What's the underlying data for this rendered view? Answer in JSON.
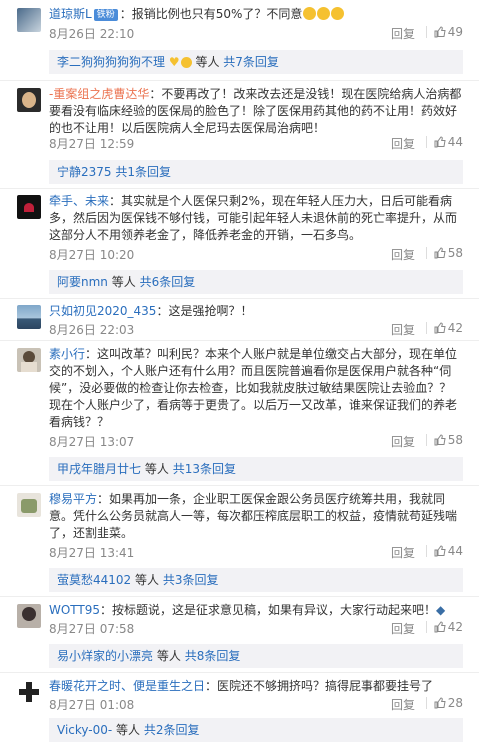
{
  "comments": [
    {
      "user": "道琼斯L",
      "badge": "铁粉",
      "text": "：报销比例也只有50%了？不同意",
      "time": "8月26日 22:10",
      "reply": "回复",
      "likes": "49",
      "sub_name": "李二狗狗狗狗狗不理",
      "sub_text": "等人",
      "sub_more": "共7条回复"
    },
    {
      "user": "-重案组之虎曹达华",
      "text": "：不要再改了！改来改去还是没钱！现在医院给病人治病都要看没有临床经验的医保局的脸色了！除了医保用药其他的药不让用！药效好的也不让用！以后医院病人全尼玛去医保局治病吧！",
      "time": "8月27日 12:59",
      "reply": "回复",
      "likes": "44",
      "sub_name": "宁静2375",
      "sub_text": "",
      "sub_more": "共1条回复"
    },
    {
      "user": "牵手、未来",
      "text": "：其实就是个人医保只剩2%，现在年轻人压力大，日后可能看病多，然后因为医保钱不够付钱，可能引起年轻人未退休前的死亡率提升，从而这部分人不用领养老金了，降低养老金的开销，一石多鸟。",
      "time": "8月27日 10:20",
      "reply": "回复",
      "likes": "58",
      "sub_name": "阿要nmn",
      "sub_text": "等人",
      "sub_more": "共6条回复"
    },
    {
      "user": "只如初见2020_435",
      "text": "：这是强抢啊？！",
      "time": "8月26日 22:03",
      "reply": "回复",
      "likes": "42"
    },
    {
      "user": "素小行",
      "text": "：这叫改革？叫利民？本来个人账户就是单位缴交占大部分，现在单位交的不划入，个人账户还有什么用？而且医院普遍看你是医保用户就各种“伺候”，没必要做的检查让你去检查，比如我就皮肤过敏结果医院让去验血？？现在个人账户少了，看病等于更贵了。以后万一又改革，谁来保证我们的养老看病钱？？",
      "time": "8月27日 13:07",
      "reply": "回复",
      "likes": "58",
      "sub_name": "甲戌年腊月廿七",
      "sub_text": "等人",
      "sub_more": "共13条回复"
    },
    {
      "user": "穆易平方",
      "text": "：如果再加一条，企业职工医保金跟公务员医疗统筹共用，我就同意。凭什么公务员就高人一等，每次都压榨底层职工的权益，疫情就苟延残喘了，还割韭菜。",
      "time": "8月27日 13:41",
      "reply": "回复",
      "likes": "44",
      "sub_name": "萤莫愁44102",
      "sub_text": "等人",
      "sub_more": "共3条回复"
    },
    {
      "user": "WOTT95",
      "text": "：按标题说，这是征求意见稿，如果有异议，大家行动起来吧！",
      "time": "8月27日 07:58",
      "reply": "回复",
      "likes": "42",
      "sub_name": "易小烊家的小漂亮",
      "sub_text": "等人",
      "sub_more": "共8条回复"
    },
    {
      "user": "春暖花开之时、便是重生之日",
      "text": "：医院还不够拥挤吗？搞得屁事都要挂号了",
      "time": "8月27日 01:08",
      "reply": "回复",
      "likes": "28",
      "sub_name": "Vicky-00-",
      "sub_text": "等人",
      "sub_more": "共2条回复"
    }
  ]
}
